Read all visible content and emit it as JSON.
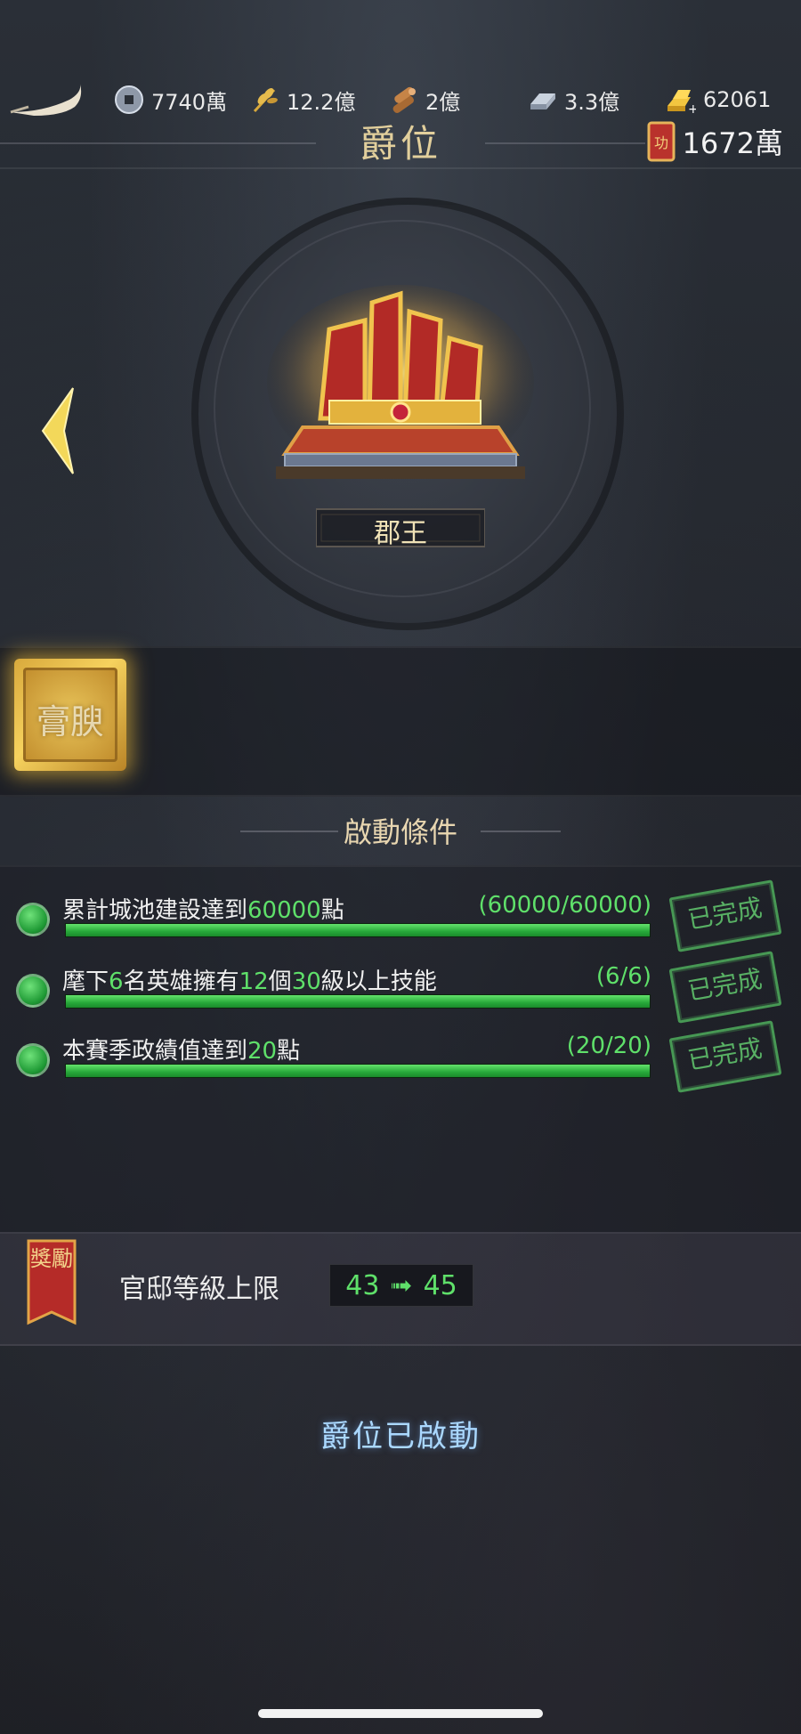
{
  "resources": [
    {
      "name": "coin",
      "value": "7740萬",
      "icon": "coin-icon"
    },
    {
      "name": "grain",
      "value": "12.2億",
      "icon": "wheat-icon"
    },
    {
      "name": "wood",
      "value": "2億",
      "icon": "wood-icon"
    },
    {
      "name": "iron",
      "value": "3.3億",
      "icon": "iron-icon"
    },
    {
      "name": "gold",
      "value": "62061",
      "icon": "gold-bar-icon"
    }
  ],
  "merit": {
    "value": "1672萬",
    "icon": "merit-token-icon"
  },
  "page": {
    "title": "爵位"
  },
  "rank": {
    "name": "郡王"
  },
  "bonus": {
    "label": "膏腴"
  },
  "conditions": {
    "heading": "啟動條件",
    "items": [
      {
        "pre": "累計城池建設達到",
        "hl1": "60000",
        "mid": "點",
        "hl2": "",
        "post": "",
        "progress": "(60000/60000)",
        "fraction": 1,
        "status": "已完成"
      },
      {
        "pre": "麾下",
        "hl1": "6",
        "mid": "名英雄擁有",
        "hl2": "12",
        "mid2": "個",
        "hl3": "30",
        "post": "級以上技能",
        "progress": "(6/6)",
        "fraction": 1,
        "status": "已完成"
      },
      {
        "pre": "本賽季政績值達到",
        "hl1": "20",
        "mid": "點",
        "hl2": "",
        "post": "",
        "progress": "(20/20)",
        "fraction": 1,
        "status": "已完成"
      }
    ]
  },
  "reward": {
    "banner": "獎勵",
    "label": "官邸等級上限",
    "from": "43",
    "arrow": "➟",
    "to": "45"
  },
  "footer": {
    "status": "爵位已啟動"
  },
  "colors": {
    "accent_green": "#5fe06a",
    "title_gold": "#e2cf9c",
    "activated_blue": "#aad8ff"
  }
}
